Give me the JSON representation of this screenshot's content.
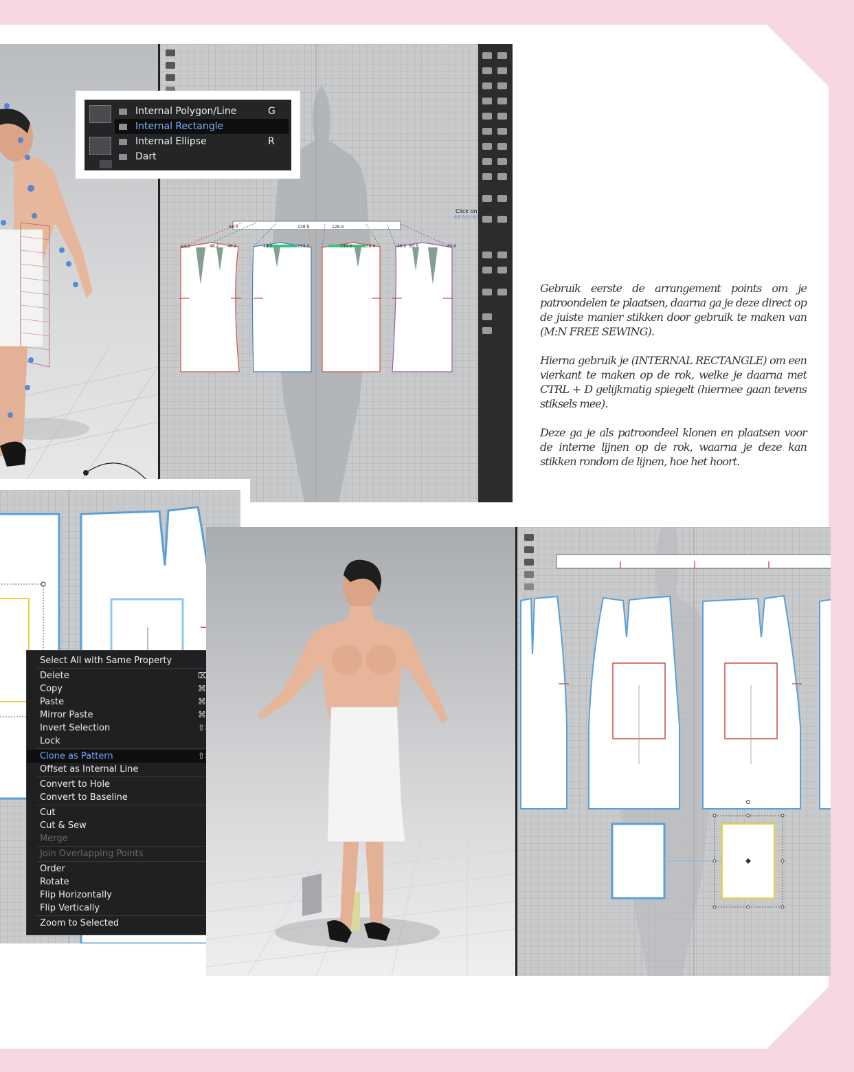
{
  "colors": {
    "page_bg": "#f6d7e2",
    "paper": "#ffffff",
    "menu_bg": "#1f2022",
    "highlight_text": "#6fa8ff",
    "viewport_grey": "#c9cacc",
    "pattern_blue": "#5aa0d8"
  },
  "top_popup": {
    "items": [
      {
        "label": "Internal Polygon/Line",
        "shortcut": "G",
        "icon": "polygon-line-icon",
        "selected": false
      },
      {
        "label": "Internal Rectangle",
        "shortcut": "",
        "icon": "rectangle-icon",
        "selected": true
      },
      {
        "label": "Internal Ellipse",
        "shortcut": "R",
        "icon": "ellipse-icon",
        "selected": false
      },
      {
        "label": "Dart",
        "shortcut": "",
        "icon": "dart-icon",
        "selected": false
      }
    ]
  },
  "pattern_labels": [
    "54.0",
    "48.2",
    "46.2",
    "128.9",
    "128.9",
    "48.2",
    "46.2",
    "56.3",
    "133.3",
    "133.3",
    "58.4",
    "50.3",
    "60.0"
  ],
  "viewport_hint": {
    "line1": "Click on a",
    "line2": "0.0 0.0 / 0.0"
  },
  "instructions": {
    "p1": "Gebruik eerste de arrangement points om je patroondelen te plaatsen, daarna ga je deze direct op de juiste manier stikken door gebruik te maken van (M:N FREE SEWING).",
    "p2": "Hierna gebruik je (INTERNAL RECTANGLE) om een vierkant te maken op de rok, welke je daarna met CTRL + D gelijkmatig spiegelt (hiermee gaan tevens stiksels mee).",
    "p3": "Deze ga je als patroondeel klonen en plaatsen voor de interne lijnen op de rok, waarna je deze kan stikken rondom de lijnen, hoe het hoort."
  },
  "context_menu": {
    "items": [
      {
        "label": "Select All with Same Property",
        "shortcut": "",
        "submenu": true,
        "state": "normal"
      },
      {
        "sep": true
      },
      {
        "label": "Delete",
        "shortcut": "⌦",
        "submenu": false,
        "state": "normal"
      },
      {
        "label": "Copy",
        "shortcut": "⌘C",
        "submenu": false,
        "state": "normal"
      },
      {
        "label": "Paste",
        "shortcut": "⌘V",
        "submenu": false,
        "state": "normal"
      },
      {
        "label": "Mirror Paste",
        "shortcut": "⌘R",
        "submenu": false,
        "state": "normal"
      },
      {
        "label": "Invert Selection",
        "shortcut": "⇧⌘I",
        "submenu": false,
        "state": "normal"
      },
      {
        "label": "Lock",
        "shortcut": "",
        "submenu": false,
        "state": "normal"
      },
      {
        "sep": true
      },
      {
        "label": "Clone as Pattern",
        "shortcut": "⇧⌘C",
        "submenu": false,
        "state": "highlighted"
      },
      {
        "label": "Offset as Internal Line",
        "shortcut": "",
        "submenu": false,
        "state": "normal"
      },
      {
        "sep": true
      },
      {
        "label": "Convert to Hole",
        "shortcut": "",
        "submenu": false,
        "state": "normal"
      },
      {
        "label": "Convert to Baseline",
        "shortcut": "",
        "submenu": false,
        "state": "normal"
      },
      {
        "sep": true
      },
      {
        "label": "Cut",
        "shortcut": "",
        "submenu": false,
        "state": "normal"
      },
      {
        "label": "Cut & Sew",
        "shortcut": "",
        "submenu": false,
        "state": "normal"
      },
      {
        "label": "Merge",
        "shortcut": "",
        "submenu": false,
        "state": "disabled"
      },
      {
        "sep": true
      },
      {
        "label": "Join Overlapping Points",
        "shortcut": "",
        "submenu": false,
        "state": "disabled"
      },
      {
        "sep": true
      },
      {
        "label": "Order",
        "shortcut": "",
        "submenu": true,
        "state": "normal"
      },
      {
        "label": "Rotate",
        "shortcut": "",
        "submenu": true,
        "state": "normal"
      },
      {
        "label": "Flip Horizontally",
        "shortcut": "",
        "submenu": false,
        "state": "normal"
      },
      {
        "label": "Flip Vertically",
        "shortcut": "",
        "submenu": false,
        "state": "normal"
      },
      {
        "sep": true
      },
      {
        "label": "Zoom to Selected",
        "shortcut": "",
        "submenu": false,
        "state": "normal"
      }
    ]
  }
}
